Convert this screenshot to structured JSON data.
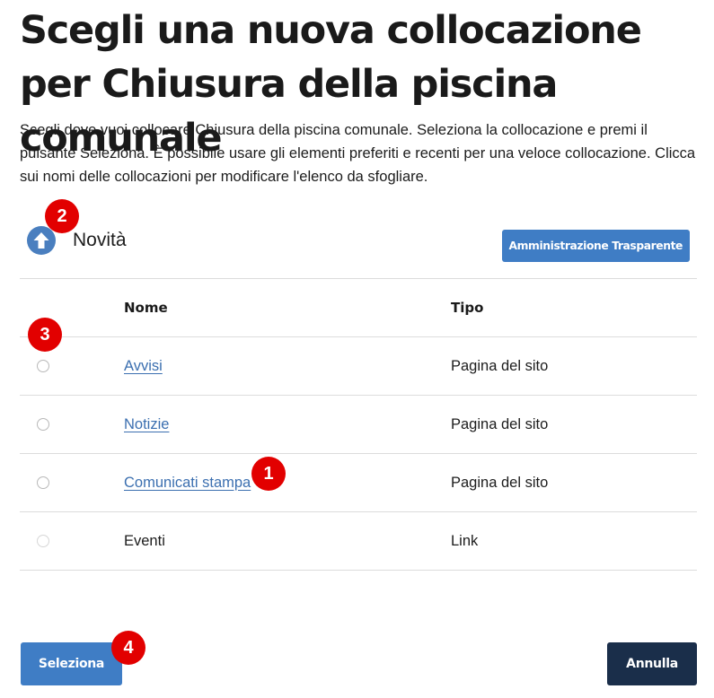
{
  "page": {
    "title": "Scegli una nuova collocazione per Chiusura della piscina comunale",
    "description": "Scegli dove vuoi collocare Chiusura della piscina comunale. Seleziona la collocazione e premi il pulsante Seleziona. È possibile usare gli elementi preferiti e recenti per una veloce collocazione. Clicca sui nomi delle collocazioni per modificare l'elenco da sfogliare."
  },
  "navigation": {
    "up_icon": "arrow-up-circle-icon",
    "current_folder": "Novità",
    "folder_button_label": "Amministrazione Trasparente"
  },
  "table": {
    "headers": {
      "name": "Nome",
      "type": "Tipo"
    },
    "rows": [
      {
        "name": "Avvisi",
        "type": "Pagina del sito",
        "linked": true
      },
      {
        "name": "Notizie",
        "type": "Pagina del sito",
        "linked": true
      },
      {
        "name": "Comunicati stampa",
        "type": "Pagina del sito",
        "linked": true
      },
      {
        "name": "Eventi",
        "type": "Link",
        "linked": false
      }
    ]
  },
  "annotations": {
    "one": "1",
    "two": "2",
    "three": "3",
    "four": "4"
  },
  "actions": {
    "select_label": "Seleziona",
    "cancel_label": "Annulla"
  },
  "colors": {
    "primary": "#3f7dc5",
    "secondary": "#1a2e4a",
    "link": "#3b6fb0",
    "annotation": "#e20000"
  }
}
